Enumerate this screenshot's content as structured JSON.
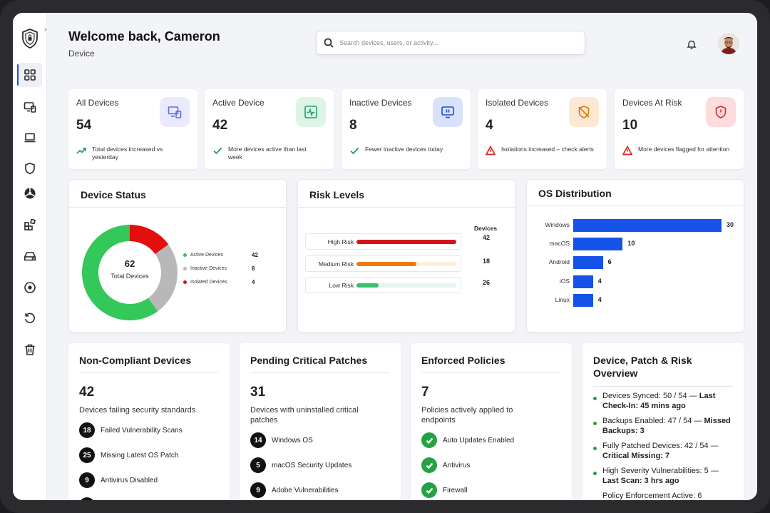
{
  "header": {
    "welcome": "Welcome back, Cameron",
    "subtitle": "Device",
    "search_placeholder": "Search devices, users, or activity..."
  },
  "sidebar": {
    "items": [
      {
        "name": "dashboard-icon"
      },
      {
        "name": "devices-icon"
      },
      {
        "name": "laptop-icon"
      },
      {
        "name": "shield-icon"
      },
      {
        "name": "biohazard-icon"
      },
      {
        "name": "apps-icon"
      },
      {
        "name": "drive-icon"
      },
      {
        "name": "disc-icon"
      },
      {
        "name": "restore-icon"
      },
      {
        "name": "trash-icon"
      }
    ]
  },
  "stats": [
    {
      "label": "All Devices",
      "value": "54",
      "note": "Total devices increased vs yesterday",
      "icon": "devices-icon",
      "note_icon": "trend-up-icon",
      "accent": "#5b6cf0",
      "bg": "#ebeafc"
    },
    {
      "label": "Active Device",
      "value": "42",
      "note": "More devices active than last week",
      "icon": "activity-icon",
      "note_icon": "check-icon",
      "accent": "#22a06b",
      "bg": "#dcf5e7"
    },
    {
      "label": "Inactive Devices",
      "value": "8",
      "note": "Fewer inactive devices today",
      "icon": "monitor-pause-icon",
      "note_icon": "check-icon",
      "accent": "#1d4ed8",
      "bg": "#d9e2fb"
    },
    {
      "label": "Isolated Devices",
      "value": "4",
      "note": "Isolations increased – check alerts",
      "icon": "shield-off-icon",
      "note_icon": "warning-icon",
      "accent": "#d97706",
      "bg": "#fde9d3"
    },
    {
      "label": "Devices At Risk",
      "value": "10",
      "note": "More devices flagged for attention",
      "icon": "shield-alert-icon",
      "note_icon": "warning-icon",
      "accent": "#dc2626",
      "bg": "#fcdcdc"
    }
  ],
  "device_status": {
    "title": "Device Status",
    "total": "62",
    "total_label": "Total Devices",
    "legend": [
      {
        "label": "Active Devices",
        "value": "42",
        "color": "#34c759"
      },
      {
        "label": "Inactive Devices",
        "value": "8",
        "color": "#b8b8b8"
      },
      {
        "label": "Isolated Devices",
        "value": "4",
        "color": "#e30e0e"
      }
    ],
    "donut_fractions": [
      0.6,
      0.25,
      0.15
    ]
  },
  "risk_levels": {
    "title": "Risk Levels",
    "header": "Devices",
    "rows": [
      {
        "label": "High Risk",
        "value": "42",
        "fill": 1.0,
        "color": "#d4141a",
        "track": "#f7d6d6"
      },
      {
        "label": "Medium Risk",
        "value": "18",
        "fill": 0.6,
        "color": "#ec7a12",
        "track": "#fdeede"
      },
      {
        "label": "Low Risk",
        "value": "26",
        "fill": 0.22,
        "color": "#36c26b",
        "track": "#e5f7ec"
      }
    ]
  },
  "os_distribution": {
    "title": "OS Distribution",
    "color": "#1553e8"
  },
  "chart_data": {
    "type": "bar",
    "title": "OS Distribution",
    "orientation": "horizontal",
    "categories": [
      "Windows",
      "macOS",
      "Android",
      "iOS",
      "Linux"
    ],
    "values": [
      30,
      10,
      6,
      4,
      4
    ],
    "xlim": [
      0,
      30
    ]
  },
  "non_compliant": {
    "title": "Non-Compliant Devices",
    "value": "42",
    "desc": "Devices failing security standards",
    "items": [
      {
        "count": "18",
        "label": "Failed Vulnerability Scans"
      },
      {
        "count": "25",
        "label": "Missing Latest OS Patch"
      },
      {
        "count": "9",
        "label": "Antivirus Disabled"
      }
    ]
  },
  "pending_patches": {
    "title": "Pending Critical Patches",
    "value": "31",
    "desc": "Devices with uninstalled critical patches",
    "items": [
      {
        "count": "14",
        "label": "Windows OS"
      },
      {
        "count": "5",
        "label": "macOS Security Updates"
      },
      {
        "count": "9",
        "label": "Adobe Vulnerabilities"
      }
    ]
  },
  "enforced_policies": {
    "title": "Enforced Policies",
    "value": "7",
    "desc": "Policies actively applied to endpoints",
    "items": [
      {
        "label": "Auto Updates Enabled"
      },
      {
        "label": "Antivirus"
      },
      {
        "label": "Firewall"
      }
    ]
  },
  "overview": {
    "title": "Device, Patch & Risk Overview",
    "items": [
      {
        "text": "Devices Synced: 50 / 54 — ",
        "bold": "Last Check-In: 45 mins ago"
      },
      {
        "text": "Backups Enabled: 47 / 54 — ",
        "bold": "Missed Backups: 3"
      },
      {
        "text": "Fully Patched Devices: 42 / 54 — ",
        "bold": "Critical Missing: 7"
      },
      {
        "text": "High Severity Vulnerabilities: 5 — ",
        "bold": "Last Scan: 3 hrs ago"
      },
      {
        "text": "Policy Enforcement Active: 6",
        "bold": ""
      }
    ]
  }
}
